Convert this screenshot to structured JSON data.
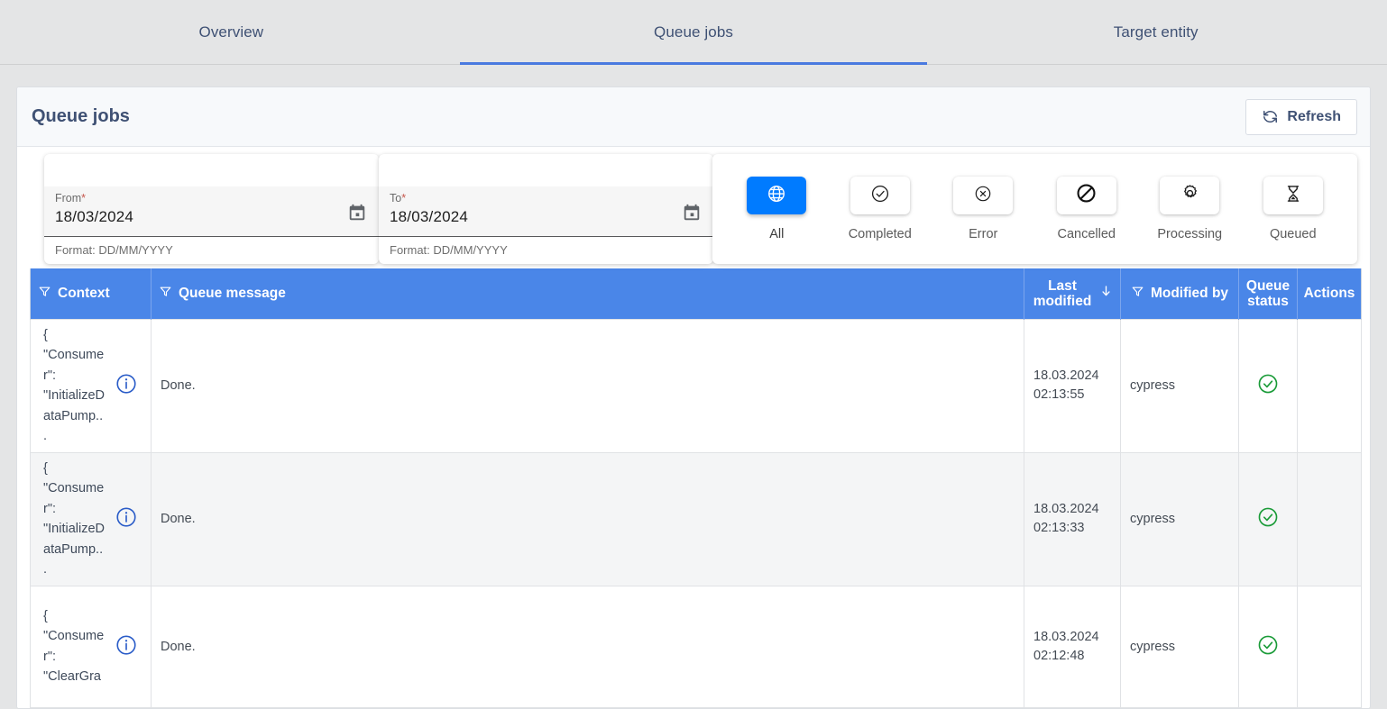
{
  "tabs": [
    {
      "label": "Overview",
      "active": false
    },
    {
      "label": "Queue jobs",
      "active": true
    },
    {
      "label": "Target entity",
      "active": false
    }
  ],
  "card": {
    "title": "Queue jobs",
    "refresh_label": "Refresh",
    "refresh_icon": "refresh-icon"
  },
  "filters": {
    "from": {
      "label": "From",
      "required_marker": "*",
      "value": "18/03/2024",
      "hint": "Format: DD/MM/YYYY",
      "calendar_icon": "calendar-icon"
    },
    "to": {
      "label": "To",
      "required_marker": "*",
      "value": "18/03/2024",
      "hint": "Format: DD/MM/YYYY",
      "calendar_icon": "calendar-icon"
    },
    "status_buttons": [
      {
        "label": "All",
        "icon": "globe-icon",
        "active": true
      },
      {
        "label": "Completed",
        "icon": "check-circle-icon",
        "active": false
      },
      {
        "label": "Error",
        "icon": "x-circle-icon",
        "active": false
      },
      {
        "label": "Cancelled",
        "icon": "block-icon",
        "active": false
      },
      {
        "label": "Processing",
        "icon": "gear-icon",
        "active": false
      },
      {
        "label": "Queued",
        "icon": "hourglass-icon",
        "active": false
      }
    ]
  },
  "table": {
    "columns": [
      {
        "label": "Context",
        "filterable": true,
        "sorted": false
      },
      {
        "label": "Queue message",
        "filterable": true,
        "sorted": false
      },
      {
        "label": "Last modified",
        "filterable": false,
        "sorted": true,
        "sort_dir": "desc"
      },
      {
        "label": "Modified by",
        "filterable": true,
        "sorted": false
      },
      {
        "label": "Queue status",
        "filterable": false,
        "sorted": false
      },
      {
        "label": "Actions",
        "filterable": false,
        "sorted": false
      }
    ],
    "rows": [
      {
        "context": "{\n\"Consume\nr\":\n\"InitializeD\nataPump..\n.",
        "info_icon": "info-icon",
        "message": "Done.",
        "last_modified": "18.03.2024\n02:13:55",
        "modified_by": "cypress",
        "status_icon": "check-circle-green-icon"
      },
      {
        "context": "{\n\"Consume\nr\":\n\"InitializeD\nataPump..\n.",
        "info_icon": "info-icon",
        "message": "Done.",
        "last_modified": "18.03.2024\n02:13:33",
        "modified_by": "cypress",
        "status_icon": "check-circle-green-icon"
      },
      {
        "context": "{\n\"Consume\nr\":\n\"ClearGra",
        "info_icon": "info-icon",
        "message": "Done.",
        "last_modified": "18.03.2024\n02:12:48",
        "modified_by": "cypress",
        "status_icon": "check-circle-green-icon"
      }
    ]
  },
  "colors": {
    "accent_blue": "#4a86e8",
    "active_button_blue": "#007bff",
    "tab_underline": "#4a7ae0",
    "status_ok_green": "#1a9b38",
    "page_background": "#e4e5e6",
    "title_text": "#3f5174"
  }
}
